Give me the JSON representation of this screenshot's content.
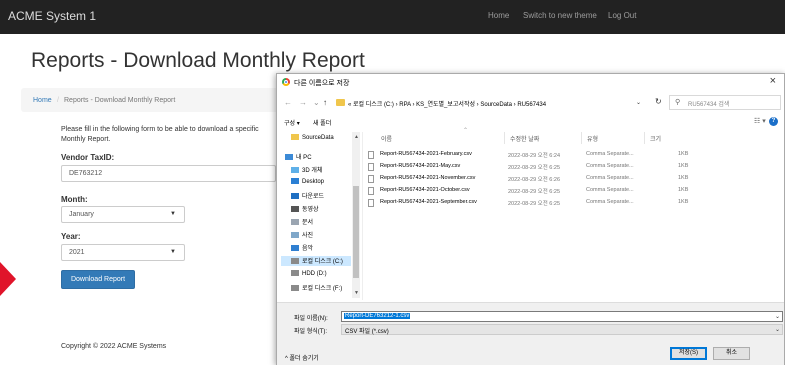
{
  "navbar": {
    "brand": "ACME System 1",
    "links": [
      "Home",
      "Switch to new theme",
      "Log Out"
    ]
  },
  "page": {
    "title": "Reports - Download Monthly Report",
    "breadcrumb": {
      "home": "Home",
      "separator": "/",
      "current": "Reports - Download Monthly Report"
    },
    "intro": "Please fill in the following form to be able to download a specific Monthly Report.",
    "vendor_label": "Vendor TaxID:",
    "vendor_value": "DE763212",
    "month_label": "Month:",
    "month_value": "January",
    "year_label": "Year:",
    "year_value": "2021",
    "download_button": "Download Report",
    "copyright": "Copyright © 2022 ACME Systems"
  },
  "dialog": {
    "title": "다른 이름으로 저장",
    "close": "×",
    "path": "« 로컬 디스크 (C:) › RPA › KS_연도별_보고서작성 › SourceData › RU567434",
    "search_placeholder": "RU567434 검색",
    "toolbar": {
      "organize": "구성 ▾",
      "new_folder": "새 폴더"
    },
    "nav_items": [
      {
        "label": "SourceData",
        "icon": "folder-icon"
      },
      {
        "label": "내 PC",
        "icon": "pc-icon"
      },
      {
        "label": "3D 개체",
        "icon": "cube-icon"
      },
      {
        "label": "Desktop",
        "icon": "desktop-icon"
      },
      {
        "label": "다운로드",
        "icon": "download-icon"
      },
      {
        "label": "동영상",
        "icon": "video-icon"
      },
      {
        "label": "문서",
        "icon": "document-icon"
      },
      {
        "label": "사진",
        "icon": "picture-icon"
      },
      {
        "label": "음악",
        "icon": "music-icon"
      },
      {
        "label": "로컬 디스크 (C:)",
        "icon": "drive-icon"
      },
      {
        "label": "HDD (D:)",
        "icon": "drive-icon"
      },
      {
        "label": "로컬 디스크 (F:)",
        "icon": "drive-icon"
      }
    ],
    "columns": {
      "name": "이름",
      "date": "수정한 날짜",
      "type": "유형",
      "size": "크기"
    },
    "files": [
      {
        "name": "Report-RU567434-2021-February.csv",
        "date": "2022-08-29 오전 6:24",
        "type": "Comma Separate...",
        "size": "1KB"
      },
      {
        "name": "Report-RU567434-2021-May.csv",
        "date": "2022-08-29 오전 6:25",
        "type": "Comma Separate...",
        "size": "1KB"
      },
      {
        "name": "Report-RU567434-2021-November.csv",
        "date": "2022-08-29 오전 6:26",
        "type": "Comma Separate...",
        "size": "1KB"
      },
      {
        "name": "Report-RU567434-2021-October.csv",
        "date": "2022-08-29 오전 6:25",
        "type": "Comma Separate...",
        "size": "1KB"
      },
      {
        "name": "Report-RU567434-2021-September.csv",
        "date": "2022-08-29 오전 6:25",
        "type": "Comma Separate...",
        "size": "1KB"
      }
    ],
    "filename_label": "파일 이름(N):",
    "filename_value": "Report-DE763212-1.csv",
    "filetype_label": "파일 형식(T):",
    "filetype_value": "CSV 파일 (*.csv)",
    "hide_folders": "^ 폴더 숨기기",
    "save_button": "저장(S)",
    "cancel_button": "취소"
  },
  "colors": {
    "navbar_bg": "#222222",
    "primary": "#337ab7",
    "arrow": "#e0142a",
    "selection": "#0078d7"
  }
}
